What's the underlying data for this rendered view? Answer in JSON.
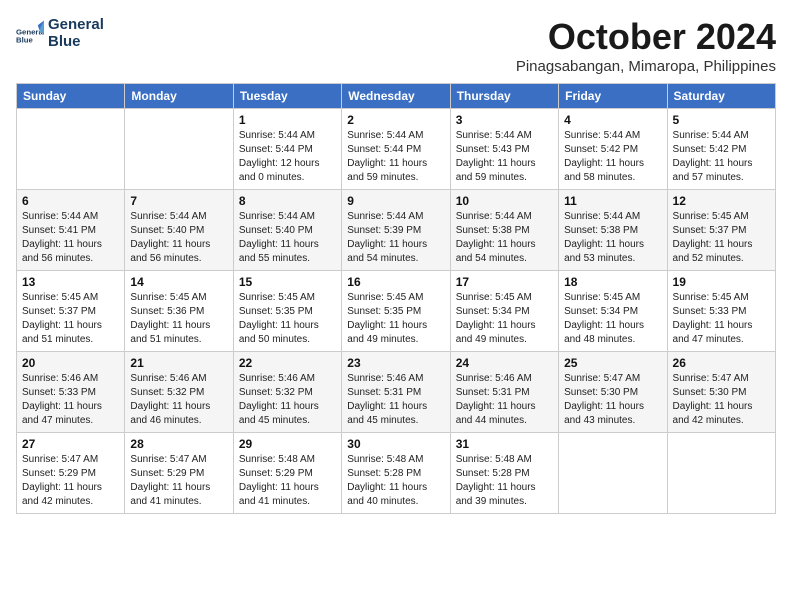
{
  "header": {
    "logo_line1": "General",
    "logo_line2": "Blue",
    "month": "October 2024",
    "location": "Pinagsabangan, Mimaropa, Philippines"
  },
  "columns": [
    "Sunday",
    "Monday",
    "Tuesday",
    "Wednesday",
    "Thursday",
    "Friday",
    "Saturday"
  ],
  "weeks": [
    [
      {
        "day": "",
        "info": ""
      },
      {
        "day": "",
        "info": ""
      },
      {
        "day": "1",
        "info": "Sunrise: 5:44 AM\nSunset: 5:44 PM\nDaylight: 12 hours and 0 minutes."
      },
      {
        "day": "2",
        "info": "Sunrise: 5:44 AM\nSunset: 5:44 PM\nDaylight: 11 hours and 59 minutes."
      },
      {
        "day": "3",
        "info": "Sunrise: 5:44 AM\nSunset: 5:43 PM\nDaylight: 11 hours and 59 minutes."
      },
      {
        "day": "4",
        "info": "Sunrise: 5:44 AM\nSunset: 5:42 PM\nDaylight: 11 hours and 58 minutes."
      },
      {
        "day": "5",
        "info": "Sunrise: 5:44 AM\nSunset: 5:42 PM\nDaylight: 11 hours and 57 minutes."
      }
    ],
    [
      {
        "day": "6",
        "info": "Sunrise: 5:44 AM\nSunset: 5:41 PM\nDaylight: 11 hours and 56 minutes."
      },
      {
        "day": "7",
        "info": "Sunrise: 5:44 AM\nSunset: 5:40 PM\nDaylight: 11 hours and 56 minutes."
      },
      {
        "day": "8",
        "info": "Sunrise: 5:44 AM\nSunset: 5:40 PM\nDaylight: 11 hours and 55 minutes."
      },
      {
        "day": "9",
        "info": "Sunrise: 5:44 AM\nSunset: 5:39 PM\nDaylight: 11 hours and 54 minutes."
      },
      {
        "day": "10",
        "info": "Sunrise: 5:44 AM\nSunset: 5:38 PM\nDaylight: 11 hours and 54 minutes."
      },
      {
        "day": "11",
        "info": "Sunrise: 5:44 AM\nSunset: 5:38 PM\nDaylight: 11 hours and 53 minutes."
      },
      {
        "day": "12",
        "info": "Sunrise: 5:45 AM\nSunset: 5:37 PM\nDaylight: 11 hours and 52 minutes."
      }
    ],
    [
      {
        "day": "13",
        "info": "Sunrise: 5:45 AM\nSunset: 5:37 PM\nDaylight: 11 hours and 51 minutes."
      },
      {
        "day": "14",
        "info": "Sunrise: 5:45 AM\nSunset: 5:36 PM\nDaylight: 11 hours and 51 minutes."
      },
      {
        "day": "15",
        "info": "Sunrise: 5:45 AM\nSunset: 5:35 PM\nDaylight: 11 hours and 50 minutes."
      },
      {
        "day": "16",
        "info": "Sunrise: 5:45 AM\nSunset: 5:35 PM\nDaylight: 11 hours and 49 minutes."
      },
      {
        "day": "17",
        "info": "Sunrise: 5:45 AM\nSunset: 5:34 PM\nDaylight: 11 hours and 49 minutes."
      },
      {
        "day": "18",
        "info": "Sunrise: 5:45 AM\nSunset: 5:34 PM\nDaylight: 11 hours and 48 minutes."
      },
      {
        "day": "19",
        "info": "Sunrise: 5:45 AM\nSunset: 5:33 PM\nDaylight: 11 hours and 47 minutes."
      }
    ],
    [
      {
        "day": "20",
        "info": "Sunrise: 5:46 AM\nSunset: 5:33 PM\nDaylight: 11 hours and 47 minutes."
      },
      {
        "day": "21",
        "info": "Sunrise: 5:46 AM\nSunset: 5:32 PM\nDaylight: 11 hours and 46 minutes."
      },
      {
        "day": "22",
        "info": "Sunrise: 5:46 AM\nSunset: 5:32 PM\nDaylight: 11 hours and 45 minutes."
      },
      {
        "day": "23",
        "info": "Sunrise: 5:46 AM\nSunset: 5:31 PM\nDaylight: 11 hours and 45 minutes."
      },
      {
        "day": "24",
        "info": "Sunrise: 5:46 AM\nSunset: 5:31 PM\nDaylight: 11 hours and 44 minutes."
      },
      {
        "day": "25",
        "info": "Sunrise: 5:47 AM\nSunset: 5:30 PM\nDaylight: 11 hours and 43 minutes."
      },
      {
        "day": "26",
        "info": "Sunrise: 5:47 AM\nSunset: 5:30 PM\nDaylight: 11 hours and 42 minutes."
      }
    ],
    [
      {
        "day": "27",
        "info": "Sunrise: 5:47 AM\nSunset: 5:29 PM\nDaylight: 11 hours and 42 minutes."
      },
      {
        "day": "28",
        "info": "Sunrise: 5:47 AM\nSunset: 5:29 PM\nDaylight: 11 hours and 41 minutes."
      },
      {
        "day": "29",
        "info": "Sunrise: 5:48 AM\nSunset: 5:29 PM\nDaylight: 11 hours and 41 minutes."
      },
      {
        "day": "30",
        "info": "Sunrise: 5:48 AM\nSunset: 5:28 PM\nDaylight: 11 hours and 40 minutes."
      },
      {
        "day": "31",
        "info": "Sunrise: 5:48 AM\nSunset: 5:28 PM\nDaylight: 11 hours and 39 minutes."
      },
      {
        "day": "",
        "info": ""
      },
      {
        "day": "",
        "info": ""
      }
    ]
  ]
}
